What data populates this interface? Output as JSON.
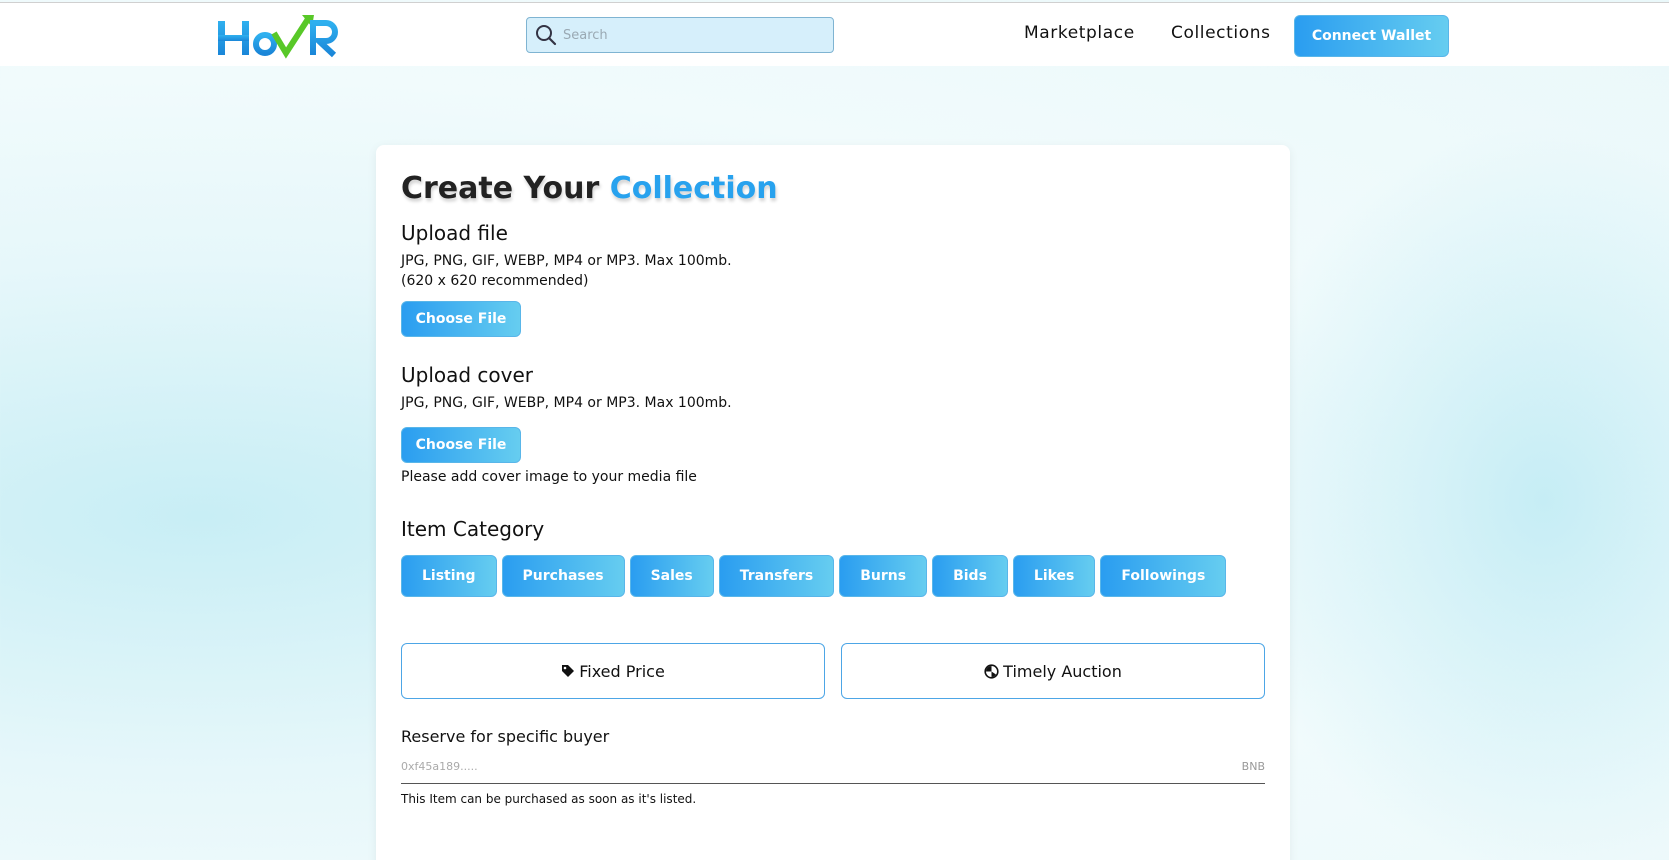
{
  "header": {
    "logo_text": "HovR",
    "search": {
      "placeholder": "Search",
      "value": ""
    },
    "nav": [
      {
        "label": "Marketplace"
      },
      {
        "label": "Collections"
      }
    ],
    "connect_label": "Connect Wallet"
  },
  "form": {
    "title_prefix": "Create Your ",
    "title_accent": "Collection",
    "upload_file": {
      "heading": "Upload file",
      "help_line1": "JPG, PNG, GIF, WEBP, MP4 or MP3. Max 100mb.",
      "help_line2": "(620 x 620 recommended)",
      "button": "Choose File"
    },
    "upload_cover": {
      "heading": "Upload cover",
      "help_line1": "JPG, PNG, GIF, WEBP, MP4 or MP3. Max 100mb.",
      "button": "Choose File",
      "note": "Please add cover image to your media file"
    },
    "category": {
      "heading": "Item Category",
      "items": [
        "Listing",
        "Purchases",
        "Sales",
        "Transfers",
        "Burns",
        "Bids",
        "Likes",
        "Followings"
      ]
    },
    "pricing": {
      "fixed_label": "Fixed Price",
      "auction_label": "Timely Auction"
    },
    "reserve": {
      "label": "Reserve for specific buyer",
      "placeholder": "0xf45a189.....",
      "unit": "BNB",
      "note": "This Item can be purchased as soon as it's listed."
    }
  },
  "colors": {
    "accent": "#28a2ee",
    "button_gradient_start": "#2a9df0",
    "button_gradient_end": "#66cdf0",
    "logo_green": "#58c828"
  }
}
